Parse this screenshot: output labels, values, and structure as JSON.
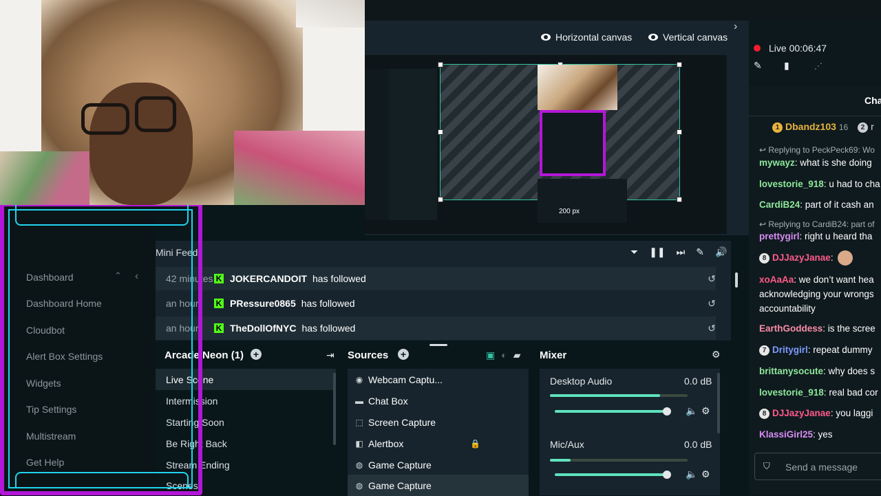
{
  "canvas_toggles": {
    "horizontal": "Horizontal canvas",
    "vertical": "Vertical canvas"
  },
  "preview": {
    "px_readout": "200 px"
  },
  "live": {
    "label": "Live",
    "timer": "00:06:47",
    "live_color": "#f01e2c"
  },
  "mini_feed": {
    "title": "Mini Feed",
    "items": [
      {
        "time": "42 minutes",
        "user": "JOKERCANDOIT",
        "action": "has followed"
      },
      {
        "time": "an hour",
        "user": "PRessure0865",
        "action": "has followed"
      },
      {
        "time": "an hour",
        "user": "TheDollOfNYC",
        "action": "has followed"
      }
    ]
  },
  "scenes": {
    "collection": "Arcade Neon (1)",
    "items": [
      "Live Scene",
      "Intermission",
      "Starting Soon",
      "Be Right Back",
      "Stream Ending",
      "Scenes"
    ]
  },
  "sources": {
    "title": "Sources",
    "items": [
      {
        "name": "Webcam Captu...",
        "icon": "webcam-icon"
      },
      {
        "name": "Chat Box",
        "icon": "chat-icon"
      },
      {
        "name": "Screen Capture",
        "icon": "screen-capture-icon"
      },
      {
        "name": "Alertbox",
        "icon": "alertbox-icon"
      },
      {
        "name": "Game Capture",
        "icon": "gamepad-icon"
      },
      {
        "name": "Game Capture",
        "icon": "gamepad-icon"
      }
    ]
  },
  "mixer": {
    "title": "Mixer",
    "channels": [
      {
        "name": "Desktop Audio",
        "db": "0.0 dB",
        "level": 0.8
      },
      {
        "name": "Mic/Aux",
        "db": "0.0 dB",
        "level": 0.15
      }
    ]
  },
  "dashboard_menu": {
    "items": [
      "Dashboard",
      "Dashboard Home",
      "Cloudbot",
      "Alert Box Settings",
      "Widgets",
      "Tip Settings",
      "Multistream",
      "Get Help"
    ]
  },
  "chat": {
    "header": "Cha",
    "top_supporter": {
      "rank": "1",
      "name": "Dbandz103",
      "count": "16",
      "rank2": "2",
      "name2": "r"
    },
    "messages": [
      {
        "reply": "Replying to PeckPeck69: Wo",
        "user": "mywayz",
        "text": ": what is she doing",
        "color": "#8ee89a"
      },
      {
        "user": "lovestorie_918",
        "text": ": u had to cha",
        "color": "#8ee89a"
      },
      {
        "user": "CardiB24",
        "text": ": part of it cash an",
        "color": "#8ee89a"
      },
      {
        "reply": "Replying to CardiB24: part of",
        "user": "prettygirl",
        "text": ": right u heard tha",
        "color": "#d98cf5"
      },
      {
        "badge": "8",
        "user": "DJJazyJanae",
        "text": ":",
        "color": "#ff5a8a"
      },
      {
        "user": "xoAaAa",
        "text": ": we don’t want hea acknowledging your wrongs accountability",
        "color": "#ff5a8a"
      },
      {
        "user": "EarthGoddess",
        "text": ": is the scree",
        "color": "#f98ca8"
      },
      {
        "badge": "7",
        "user": "Dritygirl",
        "text": ": repeat dummy",
        "color": "#7c9bff"
      },
      {
        "user": "brittanysocute",
        "text": ": why does s",
        "color": "#8ee89a"
      },
      {
        "user": "lovestorie_918",
        "text": ": real bad cor",
        "color": "#8ee89a"
      },
      {
        "badge": "8",
        "user": "DJJazyJanae",
        "text": ": you laggi",
        "color": "#ff5a8a"
      },
      {
        "user": "KlassiGirl25",
        "text": ": yes",
        "color": "#d98cf5"
      }
    ],
    "input_placeholder": "Send a message"
  },
  "colors": {
    "accent": "#31c3a2",
    "kick_green": "#53fc18",
    "neon_purple": "#b316d8",
    "neon_cyan": "#21d4ee"
  }
}
